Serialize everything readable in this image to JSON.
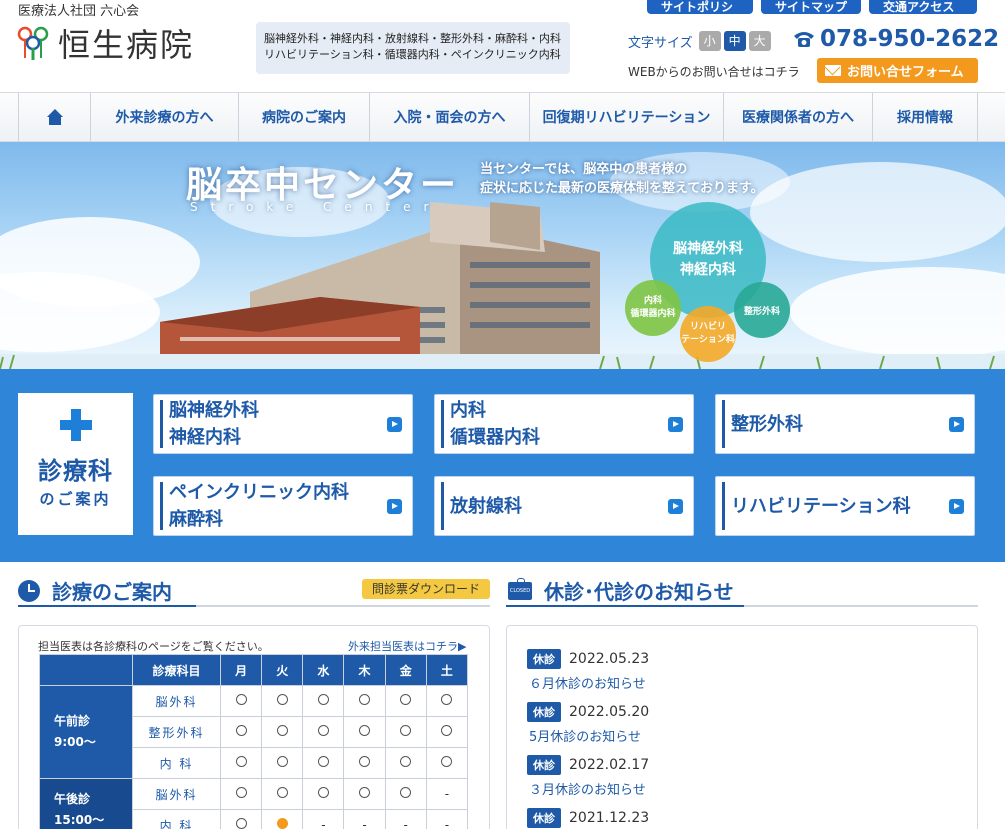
{
  "header": {
    "org": "医療法人社団 六心会",
    "logo_text": "恒生病院",
    "departments_line1": "脳神経外科・神経内科・放射線科・整形外科・麻酔科・内科",
    "departments_line2": "リハビリテーション科・循環器内科・ペインクリニック内科",
    "top_tabs": [
      "サイトポリシー",
      "サイトマップ",
      "交通アクセス"
    ],
    "font_size_label": "文字サイズ",
    "font_sizes": [
      "小",
      "中",
      "大"
    ],
    "phone": "078-950-2622",
    "web_contact_text": "WEBからのお問い合せはコチラ",
    "contact_button": "お問い合せフォーム"
  },
  "nav": {
    "items": [
      "外来診療の方へ",
      "病院のご案内",
      "入院・面会の方へ",
      "回復期リハビリテーション",
      "医療関係者の方へ",
      "採用情報"
    ]
  },
  "hero": {
    "title": "脳卒中センター",
    "subtitle": "Stroke Center",
    "desc_line1": "当センターでは、脳卒中の患者様の",
    "desc_line2": "症状に応じた最新の医療体制を整えております。",
    "bubble_main_1": "脳神経外科",
    "bubble_main_2": "神経内科",
    "bubble_left_1": "内科",
    "bubble_left_2": "循環器内科",
    "bubble_mid_1": "リハビリ",
    "bubble_mid_2": "テーション科",
    "bubble_right": "整形外科"
  },
  "departments": {
    "intro_big": "診療科",
    "intro_small": "のご案内",
    "cards": [
      {
        "line1": "脳神経外科",
        "line2": "神経内科"
      },
      {
        "line1": "内科",
        "line2": "循環器内科"
      },
      {
        "line1": "整形外科",
        "line2": ""
      },
      {
        "line1": "ペインクリニック内科",
        "line2": "麻酔科"
      },
      {
        "line1": "放射線科",
        "line2": ""
      },
      {
        "line1": "リハビリテーション科",
        "line2": ""
      }
    ]
  },
  "consultation": {
    "title": "診療のご案内",
    "download": "問診票ダウンロード",
    "note": "担当医表は各診療科のページをご覧ください。",
    "link": "外来担当医表はコチラ▶",
    "table": {
      "header": [
        "診療科目",
        "月",
        "火",
        "水",
        "木",
        "金",
        "土"
      ],
      "am_label_1": "午前診",
      "am_label_2": "9:00〜",
      "pm_label_1": "午後診",
      "pm_label_2": "15:00〜",
      "rows": [
        {
          "dept": "脳外科",
          "cells": [
            "○",
            "○",
            "○",
            "○",
            "○",
            "○"
          ]
        },
        {
          "dept": "整形外科",
          "cells": [
            "○",
            "○",
            "○",
            "○",
            "○",
            "○"
          ]
        },
        {
          "dept": "内 科",
          "cells": [
            "○",
            "○",
            "○",
            "○",
            "○",
            "○"
          ]
        },
        {
          "dept": "脳外科",
          "cells": [
            "○",
            "○",
            "○",
            "○",
            "○",
            "-"
          ]
        },
        {
          "dept": "内 科",
          "cells": [
            "○",
            "●",
            "-",
            "-",
            "-",
            "-"
          ]
        }
      ]
    }
  },
  "notices": {
    "title": "休診･代診のお知らせ",
    "icon_text": "CLOSED",
    "items": [
      {
        "badge": "休診",
        "date": "2022.05.23",
        "text": "６月休診のお知らせ"
      },
      {
        "badge": "休診",
        "date": "2022.05.20",
        "text": "5月休診のお知らせ"
      },
      {
        "badge": "休診",
        "date": "2022.02.17",
        "text": "３月休診のお知らせ"
      },
      {
        "badge": "休診",
        "date": "2021.12.23",
        "text": ""
      }
    ]
  },
  "colors": {
    "primary": "#1e5aa8",
    "accent_orange": "#f39a1e",
    "dept_background": "#2f86d9",
    "download_yellow": "#f5c842"
  }
}
